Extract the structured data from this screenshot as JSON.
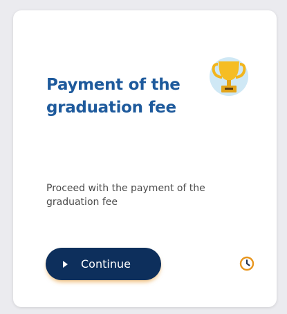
{
  "card": {
    "title": "Payment of the graduation fee",
    "description": "Proceed with the payment of the graduation fee",
    "continue_label": "Continue",
    "trophy_icon": "trophy-icon",
    "status_icon": "clock-icon"
  },
  "colors": {
    "title": "#1e5a9c",
    "button": "#0d2f5c",
    "accent": "#e8961e",
    "trophy_bg": "#cfe8f5"
  }
}
